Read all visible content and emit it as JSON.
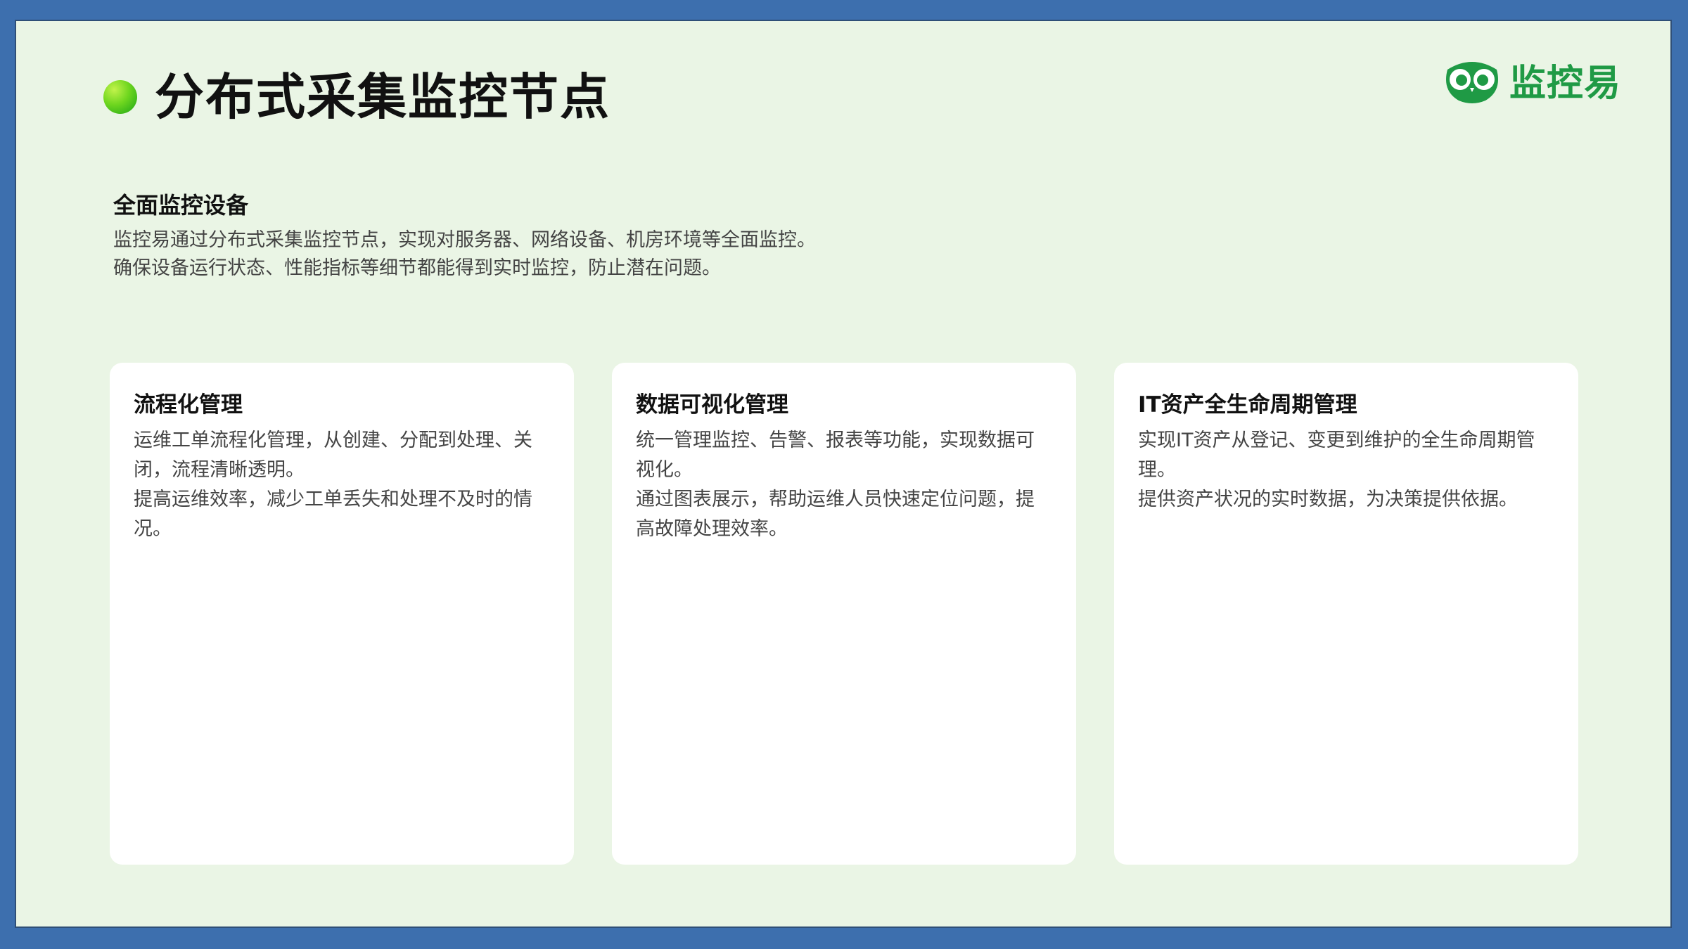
{
  "slide": {
    "title": "分布式采集监控节点",
    "logo_text": "监控易",
    "colors": {
      "brand": "#1f9a45",
      "frame": "#3d6fae",
      "background": "#eaf5e5",
      "card": "#ffffff"
    }
  },
  "intro": {
    "title": "全面监控设备",
    "lines": [
      "监控易通过分布式采集监控节点，实现对服务器、网络设备、机房环境等全面监控。",
      "确保设备运行状态、性能指标等细节都能得到实时监控，防止潜在问题。"
    ]
  },
  "cards": [
    {
      "title": "流程化管理",
      "lines": [
        "运维工单流程化管理，从创建、分配到处理、关闭，流程清晰透明。",
        "提高运维效率，减少工单丢失和处理不及时的情况。"
      ]
    },
    {
      "title": "数据可视化管理",
      "lines": [
        "统一管理监控、告警、报表等功能，实现数据可视化。",
        "通过图表展示，帮助运维人员快速定位问题，提高故障处理效率。"
      ]
    },
    {
      "title": "IT资产全生命周期管理",
      "lines": [
        "实现IT资产从登记、变更到维护的全生命周期管理。",
        "提供资产状况的实时数据，为决策提供依据。"
      ]
    }
  ]
}
